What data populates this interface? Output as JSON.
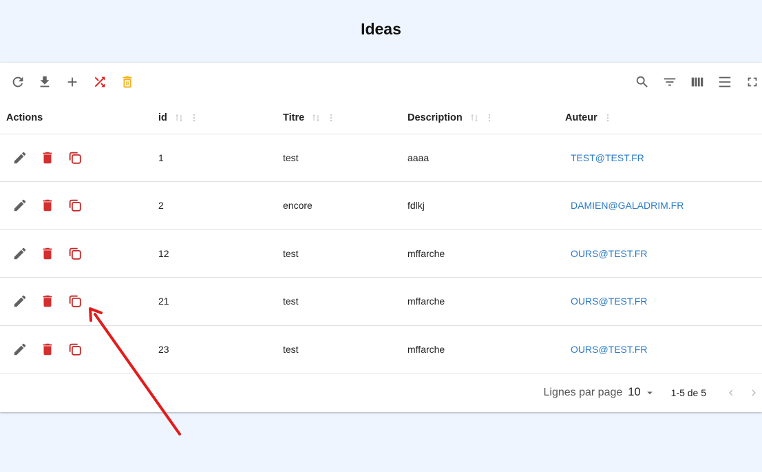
{
  "header": {
    "title": "Ideas"
  },
  "toolbar": {
    "left_icons": [
      "refresh-icon",
      "download-icon",
      "add-icon",
      "shuffle-icon",
      "delete-all-icon"
    ],
    "right_icons": [
      "search-icon",
      "filter-icon",
      "columns-icon",
      "density-icon",
      "fullscreen-icon"
    ],
    "colors": {
      "default": "#616161",
      "shuffle": "#e31b1b",
      "delete": "#f5b01b"
    }
  },
  "table": {
    "columns": [
      {
        "key": "actions",
        "label": "Actions",
        "sortable": false,
        "menu": false
      },
      {
        "key": "id",
        "label": "id",
        "sortable": true,
        "menu": true
      },
      {
        "key": "titre",
        "label": "Titre",
        "sortable": true,
        "menu": true
      },
      {
        "key": "description",
        "label": "Description",
        "sortable": true,
        "menu": true
      },
      {
        "key": "auteur",
        "label": "Auteur",
        "sortable": false,
        "menu": true
      }
    ],
    "rows": [
      {
        "id": "1",
        "titre": "test",
        "description": "aaaa",
        "auteur": "TEST@TEST.FR"
      },
      {
        "id": "2",
        "titre": "encore",
        "description": "fdlkj",
        "auteur": "DAMIEN@GALADRIM.FR"
      },
      {
        "id": "12",
        "titre": "test",
        "description": "mffarche",
        "auteur": "OURS@TEST.FR"
      },
      {
        "id": "21",
        "titre": "test",
        "description": "mffarche",
        "auteur": "OURS@TEST.FR"
      },
      {
        "id": "23",
        "titre": "test",
        "description": "mffarche",
        "auteur": "OURS@TEST.FR"
      }
    ],
    "row_actions": [
      "edit-icon",
      "delete-icon",
      "duplicate-icon"
    ],
    "colors": {
      "edit": "#616161",
      "delete": "#d32f2f",
      "duplicate": "#c62828",
      "author_link": "#2a7ac7"
    }
  },
  "footer": {
    "rows_per_page_label": "Lignes par page",
    "rows_per_page_value": "10",
    "range_label": "1-5 de 5"
  },
  "annotation": {
    "type": "arrow",
    "color": "#e31b1b",
    "points_to": "duplicate-icon row 4"
  }
}
